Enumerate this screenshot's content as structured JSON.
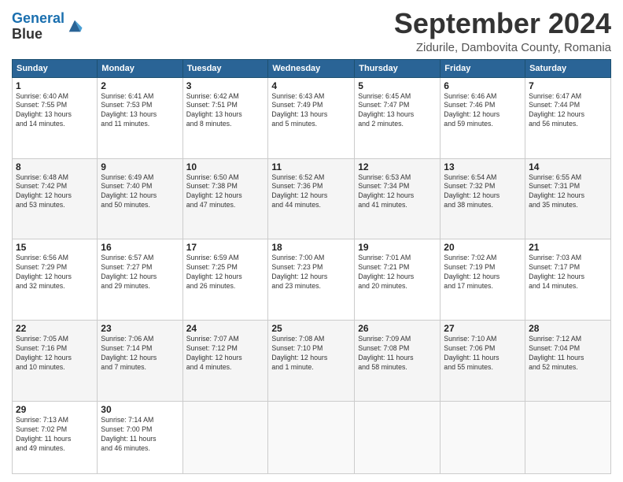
{
  "header": {
    "logo_line1": "General",
    "logo_line2": "Blue",
    "month": "September 2024",
    "location": "Zidurile, Dambovita County, Romania"
  },
  "days_of_week": [
    "Sunday",
    "Monday",
    "Tuesday",
    "Wednesday",
    "Thursday",
    "Friday",
    "Saturday"
  ],
  "weeks": [
    [
      {
        "day": "1",
        "info": "Sunrise: 6:40 AM\nSunset: 7:55 PM\nDaylight: 13 hours\nand 14 minutes."
      },
      {
        "day": "2",
        "info": "Sunrise: 6:41 AM\nSunset: 7:53 PM\nDaylight: 13 hours\nand 11 minutes."
      },
      {
        "day": "3",
        "info": "Sunrise: 6:42 AM\nSunset: 7:51 PM\nDaylight: 13 hours\nand 8 minutes."
      },
      {
        "day": "4",
        "info": "Sunrise: 6:43 AM\nSunset: 7:49 PM\nDaylight: 13 hours\nand 5 minutes."
      },
      {
        "day": "5",
        "info": "Sunrise: 6:45 AM\nSunset: 7:47 PM\nDaylight: 13 hours\nand 2 minutes."
      },
      {
        "day": "6",
        "info": "Sunrise: 6:46 AM\nSunset: 7:46 PM\nDaylight: 12 hours\nand 59 minutes."
      },
      {
        "day": "7",
        "info": "Sunrise: 6:47 AM\nSunset: 7:44 PM\nDaylight: 12 hours\nand 56 minutes."
      }
    ],
    [
      {
        "day": "8",
        "info": "Sunrise: 6:48 AM\nSunset: 7:42 PM\nDaylight: 12 hours\nand 53 minutes."
      },
      {
        "day": "9",
        "info": "Sunrise: 6:49 AM\nSunset: 7:40 PM\nDaylight: 12 hours\nand 50 minutes."
      },
      {
        "day": "10",
        "info": "Sunrise: 6:50 AM\nSunset: 7:38 PM\nDaylight: 12 hours\nand 47 minutes."
      },
      {
        "day": "11",
        "info": "Sunrise: 6:52 AM\nSunset: 7:36 PM\nDaylight: 12 hours\nand 44 minutes."
      },
      {
        "day": "12",
        "info": "Sunrise: 6:53 AM\nSunset: 7:34 PM\nDaylight: 12 hours\nand 41 minutes."
      },
      {
        "day": "13",
        "info": "Sunrise: 6:54 AM\nSunset: 7:32 PM\nDaylight: 12 hours\nand 38 minutes."
      },
      {
        "day": "14",
        "info": "Sunrise: 6:55 AM\nSunset: 7:31 PM\nDaylight: 12 hours\nand 35 minutes."
      }
    ],
    [
      {
        "day": "15",
        "info": "Sunrise: 6:56 AM\nSunset: 7:29 PM\nDaylight: 12 hours\nand 32 minutes."
      },
      {
        "day": "16",
        "info": "Sunrise: 6:57 AM\nSunset: 7:27 PM\nDaylight: 12 hours\nand 29 minutes."
      },
      {
        "day": "17",
        "info": "Sunrise: 6:59 AM\nSunset: 7:25 PM\nDaylight: 12 hours\nand 26 minutes."
      },
      {
        "day": "18",
        "info": "Sunrise: 7:00 AM\nSunset: 7:23 PM\nDaylight: 12 hours\nand 23 minutes."
      },
      {
        "day": "19",
        "info": "Sunrise: 7:01 AM\nSunset: 7:21 PM\nDaylight: 12 hours\nand 20 minutes."
      },
      {
        "day": "20",
        "info": "Sunrise: 7:02 AM\nSunset: 7:19 PM\nDaylight: 12 hours\nand 17 minutes."
      },
      {
        "day": "21",
        "info": "Sunrise: 7:03 AM\nSunset: 7:17 PM\nDaylight: 12 hours\nand 14 minutes."
      }
    ],
    [
      {
        "day": "22",
        "info": "Sunrise: 7:05 AM\nSunset: 7:16 PM\nDaylight: 12 hours\nand 10 minutes."
      },
      {
        "day": "23",
        "info": "Sunrise: 7:06 AM\nSunset: 7:14 PM\nDaylight: 12 hours\nand 7 minutes."
      },
      {
        "day": "24",
        "info": "Sunrise: 7:07 AM\nSunset: 7:12 PM\nDaylight: 12 hours\nand 4 minutes."
      },
      {
        "day": "25",
        "info": "Sunrise: 7:08 AM\nSunset: 7:10 PM\nDaylight: 12 hours\nand 1 minute."
      },
      {
        "day": "26",
        "info": "Sunrise: 7:09 AM\nSunset: 7:08 PM\nDaylight: 11 hours\nand 58 minutes."
      },
      {
        "day": "27",
        "info": "Sunrise: 7:10 AM\nSunset: 7:06 PM\nDaylight: 11 hours\nand 55 minutes."
      },
      {
        "day": "28",
        "info": "Sunrise: 7:12 AM\nSunset: 7:04 PM\nDaylight: 11 hours\nand 52 minutes."
      }
    ],
    [
      {
        "day": "29",
        "info": "Sunrise: 7:13 AM\nSunset: 7:02 PM\nDaylight: 11 hours\nand 49 minutes."
      },
      {
        "day": "30",
        "info": "Sunrise: 7:14 AM\nSunset: 7:00 PM\nDaylight: 11 hours\nand 46 minutes."
      },
      {
        "day": "",
        "info": ""
      },
      {
        "day": "",
        "info": ""
      },
      {
        "day": "",
        "info": ""
      },
      {
        "day": "",
        "info": ""
      },
      {
        "day": "",
        "info": ""
      }
    ]
  ]
}
